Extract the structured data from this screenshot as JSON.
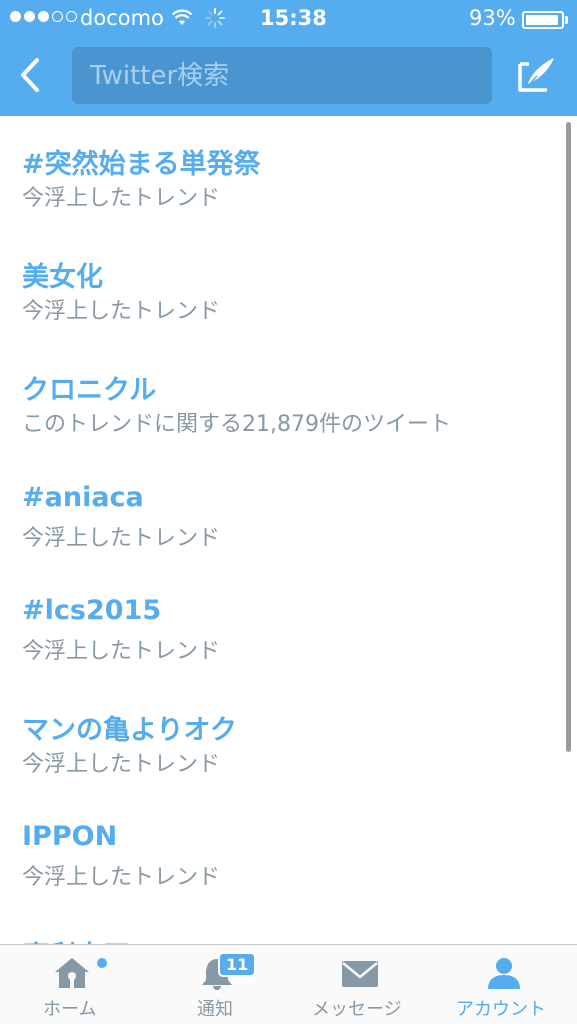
{
  "status_bar": {
    "carrier": "docomo",
    "time": "15:38",
    "battery_percent": "93%",
    "battery_level": 0.93,
    "signal_dots_filled": 3,
    "signal_dots_total": 5
  },
  "nav": {
    "back_icon": "chevron-left-icon",
    "search_placeholder": "Twitter検索",
    "compose_icon": "compose-quill-icon"
  },
  "trends": [
    {
      "name": "#突然始まる単発祭",
      "desc": "今浮上したトレンド"
    },
    {
      "name": "美女化",
      "desc": "今浮上したトレンド"
    },
    {
      "name": "クロニクル",
      "desc": "このトレンドに関する21,879件のツイート"
    },
    {
      "name": "#aniaca",
      "desc": "今浮上したトレンド"
    },
    {
      "name": "#lcs2015",
      "desc": "今浮上したトレンド"
    },
    {
      "name": "マンの亀よりオク",
      "desc": "今浮上したトレンド"
    },
    {
      "name": "IPPON",
      "desc": "今浮上したトレンド"
    },
    {
      "name": "魔利支天",
      "desc": ""
    }
  ],
  "tab_bar": {
    "tabs": [
      {
        "label": "ホーム",
        "icon": "home-icon",
        "active": false
      },
      {
        "label": "通知",
        "icon": "bell-icon",
        "active": false,
        "badge": "11"
      },
      {
        "label": "メッセージ",
        "icon": "envelope-icon",
        "active": false
      },
      {
        "label": "アカウント",
        "icon": "person-icon",
        "active": true
      }
    ]
  },
  "colors": {
    "accent": "#55acee",
    "search_field": "#4a95cf",
    "secondary_text": "#8899a6"
  }
}
